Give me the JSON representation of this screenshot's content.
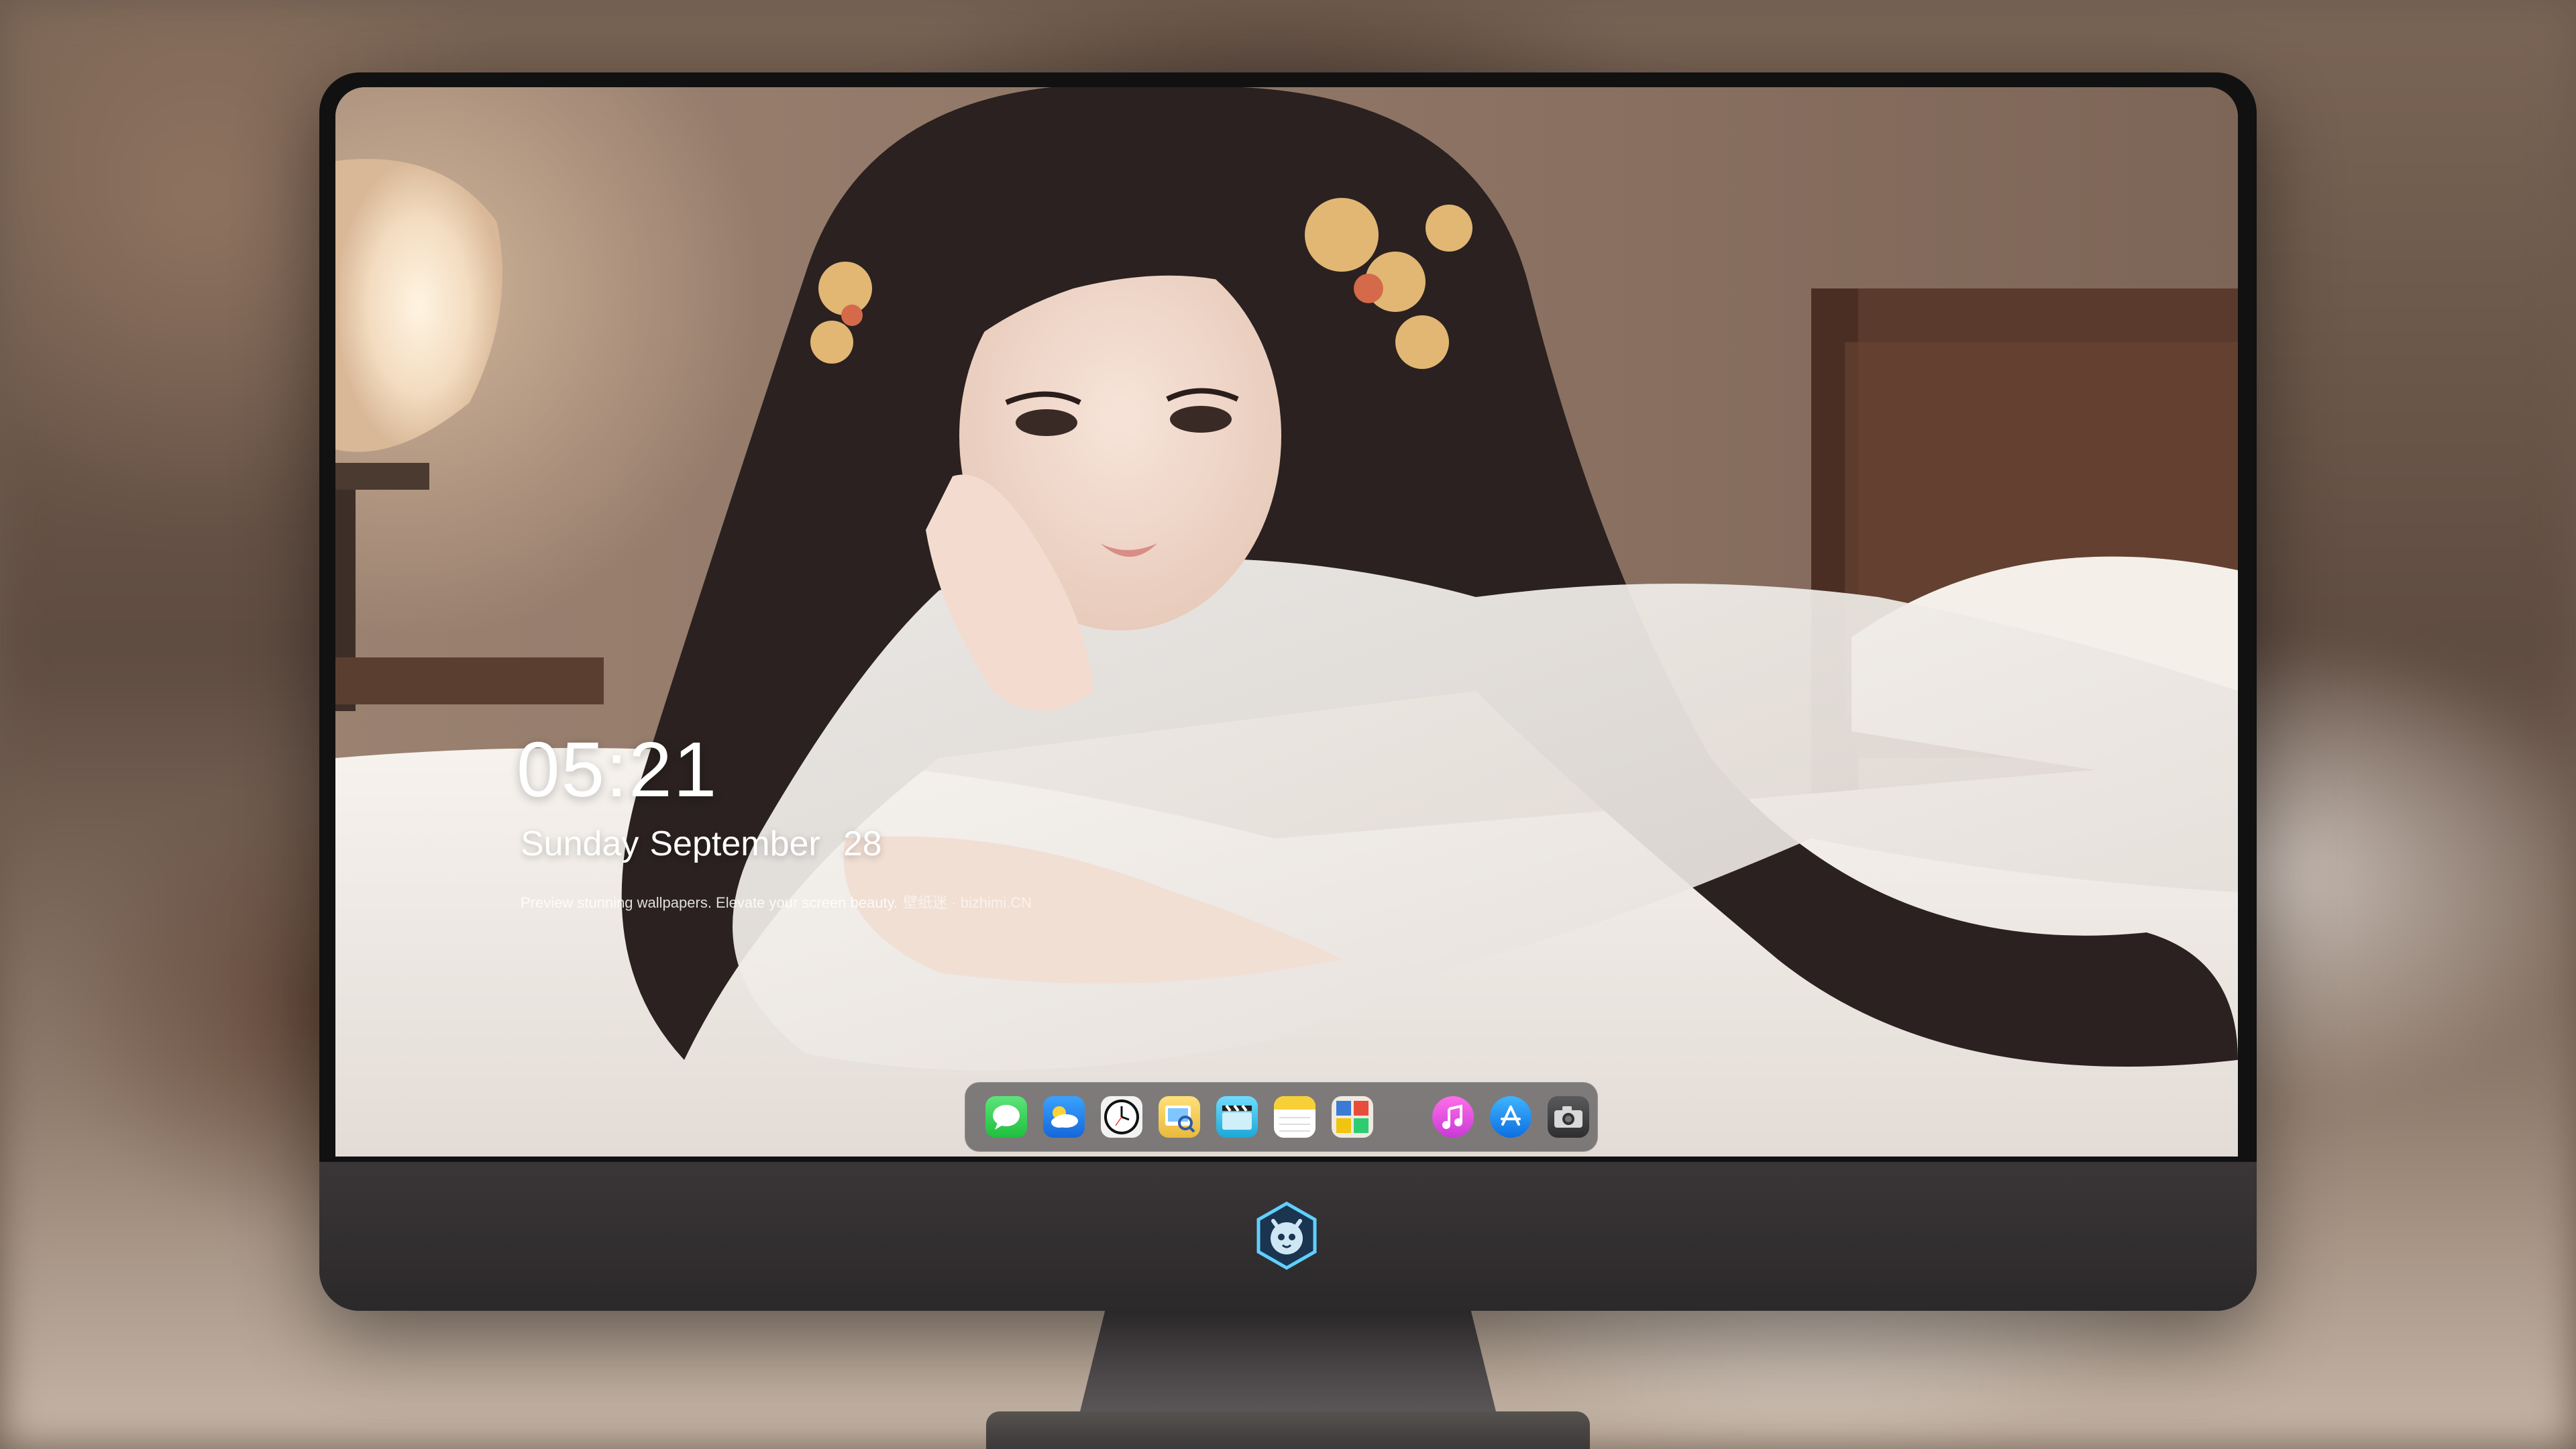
{
  "lock_screen": {
    "time": "05:21",
    "weekday": "Sunday",
    "month": "September",
    "day": "28",
    "tagline": "Preview stunning wallpapers. Elevate your screen beauty.",
    "tagline_site": "壁纸迷 · bizhimi.CN"
  },
  "dock": {
    "apps": [
      {
        "name": "messages-icon",
        "color": "#2ecc52"
      },
      {
        "name": "weather-icon",
        "color": "#2a8cf0"
      },
      {
        "name": "clock-icon",
        "color": "#111111"
      },
      {
        "name": "preview-icon",
        "color": "#e9b93c"
      },
      {
        "name": "video-icon",
        "color": "#2bbde8"
      },
      {
        "name": "notes-icon",
        "color": "#f7d038"
      },
      {
        "name": "photo-booth-icon",
        "color": "#e7e3d9"
      }
    ],
    "pinned": [
      {
        "name": "music-icon",
        "color": "#e53fd8"
      },
      {
        "name": "app-store-icon",
        "color": "#1a8cff"
      },
      {
        "name": "camera-icon",
        "color": "#3a3a3c"
      }
    ]
  },
  "monitor": {
    "logo": "dragon-badge-icon"
  }
}
